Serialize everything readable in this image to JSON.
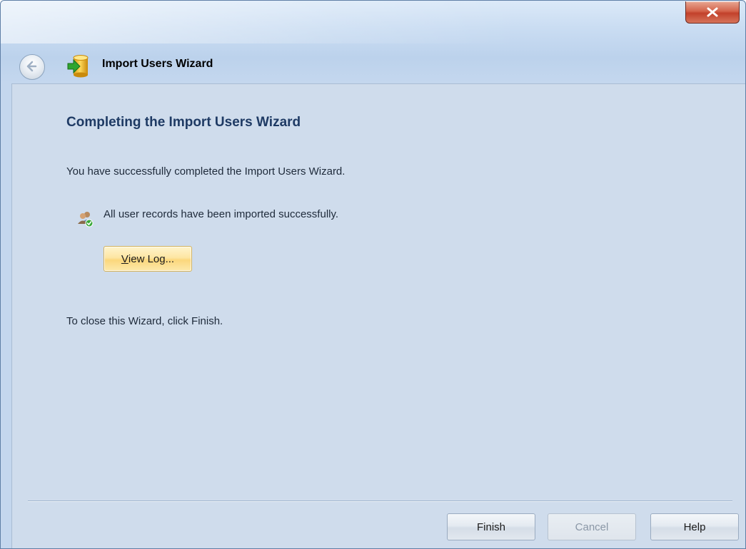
{
  "window": {
    "title": "Import Users Wizard",
    "close_label": "x"
  },
  "page": {
    "heading": "Completing the Import Users Wizard",
    "success_message": "You have successfully completed the Import Users Wizard.",
    "status_message": "All user records have been imported successfully.",
    "view_log": {
      "accel": "V",
      "rest": "iew Log..."
    },
    "close_hint": "To close this Wizard, click Finish."
  },
  "buttons": {
    "finish": "Finish",
    "cancel": "Cancel",
    "help": "Help"
  },
  "icons": {
    "back": "back-arrow-icon",
    "wizard": "import-database-icon",
    "status": "users-check-icon",
    "close": "close-icon"
  },
  "colors": {
    "heading": "#1e3a64",
    "content_bg": "#cfdcec",
    "view_log_button": "#fbd77c",
    "close_button": "#c2412b"
  }
}
